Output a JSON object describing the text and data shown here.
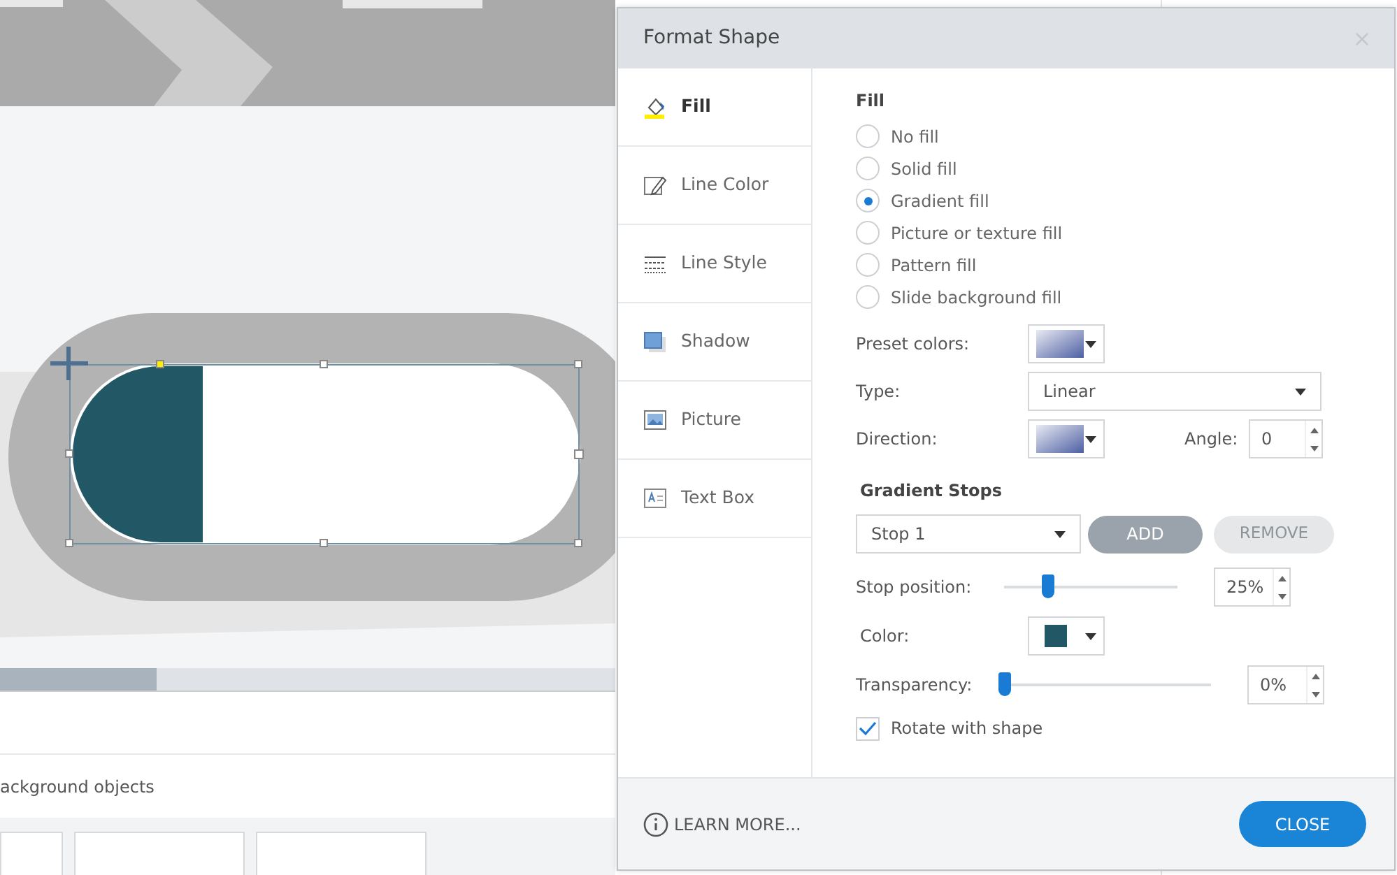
{
  "background": {
    "caption": "ackground objects",
    "thumbnails": [
      {
        "kind": "slide"
      },
      {
        "kind": "slide"
      },
      {
        "kind": "slide"
      }
    ]
  },
  "dialog": {
    "title": "Format Shape",
    "tabs": [
      {
        "label": "Fill",
        "kind": "fill",
        "selected": true
      },
      {
        "label": "Line Color",
        "kind": "line-color",
        "selected": false
      },
      {
        "label": "Line Style",
        "kind": "line-style",
        "selected": false
      },
      {
        "label": "Shadow",
        "kind": "shadow",
        "selected": false
      },
      {
        "label": "Picture",
        "kind": "picture",
        "selected": false
      },
      {
        "label": "Text Box",
        "kind": "text-box",
        "selected": false
      }
    ],
    "fill_heading": "Fill",
    "fill_options": [
      {
        "label": "No fill",
        "selected": false
      },
      {
        "label": "Solid fill",
        "selected": false
      },
      {
        "label": "Gradient fill",
        "selected": true
      },
      {
        "label": "Picture or texture fill",
        "selected": false
      },
      {
        "label": "Pattern fill",
        "selected": false
      },
      {
        "label": "Slide background fill",
        "selected": false
      }
    ],
    "preset_colors": {
      "label": "Preset colors:"
    },
    "type": {
      "label": "Type:",
      "value": "Linear"
    },
    "direction": {
      "label": "Direction:"
    },
    "angle": {
      "label": "Angle:",
      "value": "0"
    },
    "gradient_stops": {
      "heading": "Gradient Stops",
      "stop": "Stop 1",
      "buttons": [
        {
          "label": "ADD",
          "disabled": false
        },
        {
          "label": "REMOVE",
          "disabled": true
        }
      ]
    },
    "stop_position": {
      "label": "Stop position:",
      "level": 0.25,
      "value": "25%"
    },
    "color": {
      "label": "Color:",
      "color": "#225866"
    },
    "transparency": {
      "label": "Transparency:",
      "level": 0,
      "value": "0%"
    },
    "rotate_with_shape": {
      "label": "Rotate with shape",
      "checked": true
    },
    "learn_more": "LEARN MORE...",
    "close": "CLOSE"
  }
}
